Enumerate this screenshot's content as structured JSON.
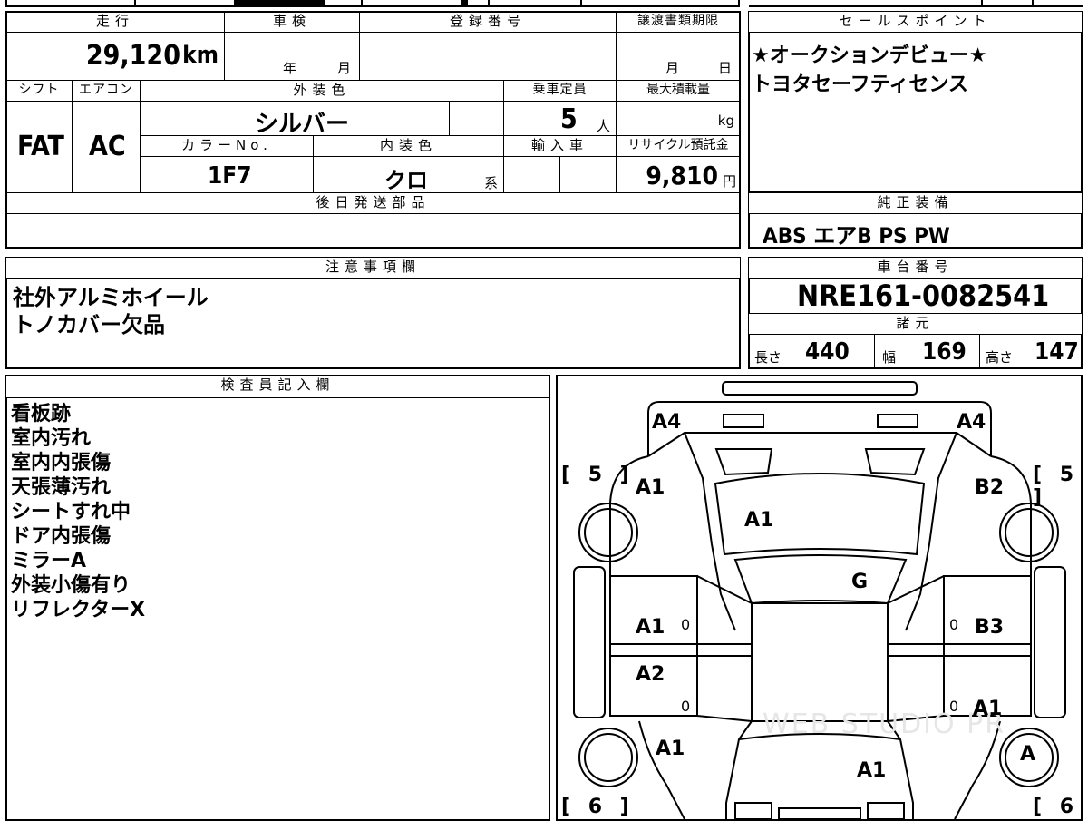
{
  "vehicle": {
    "mileage": {
      "header": "走行",
      "value": "29,120",
      "unit": "km"
    },
    "shaken": {
      "header": "車検",
      "year_unit": "年",
      "month_unit": "月"
    },
    "registration_no": {
      "header": "登録番号"
    },
    "transfer_deadline": {
      "header": "譲渡書類期限",
      "month_unit": "月",
      "day_unit": "日"
    },
    "shift": {
      "header": "シフト",
      "value": "FAT"
    },
    "aircon": {
      "header": "エアコン",
      "value": "AC"
    },
    "exterior_color": {
      "header": "外装色",
      "value": "シルバー"
    },
    "capacity": {
      "header": "乗車定員",
      "value": "5",
      "unit": "人"
    },
    "max_load": {
      "header": "最大積載量",
      "unit": "kg"
    },
    "color_no": {
      "header": "カラーNo.",
      "value": "1F7"
    },
    "interior_color": {
      "header": "内装色",
      "value": "クロ",
      "unit": "系"
    },
    "import": {
      "header": "輸入車"
    },
    "recycle_fee": {
      "header": "リサイクル預託金",
      "value": "9,810",
      "unit": "円"
    },
    "later_parts": {
      "header": "後日発送部品"
    }
  },
  "sales_points": {
    "header": "セールスポイント",
    "lines": [
      "★オークションデビュー★",
      "トヨタセーフティセンス"
    ]
  },
  "equipment": {
    "header": "純正装備",
    "value": "ABS エアB PS PW"
  },
  "notes": {
    "header": "注意事項欄",
    "lines": [
      "社外アルミホイール",
      "トノカバー欠品"
    ]
  },
  "chassis": {
    "header": "車台番号",
    "value": "NRE161-0082541"
  },
  "specs": {
    "header": "諸元",
    "length_label": "長さ",
    "length": "440",
    "width_label": "幅",
    "width": "169",
    "height_label": "高さ",
    "height": "147"
  },
  "inspector": {
    "header": "検査員記入欄",
    "lines": [
      "看板跡",
      "室内汚れ",
      "室内内張傷",
      "天張薄汚れ",
      "シートすれ中",
      "ドア内張傷",
      "ミラーA",
      "外装小傷有り",
      "リフレクターX"
    ]
  },
  "diagram": {
    "grades": {
      "rear_left": "A4",
      "rear_right": "A4",
      "rear_quarter_left": "A1",
      "rear_quarter_right": "B2",
      "rear_glass": "A1",
      "roof": "G",
      "rear_door_left": "A1",
      "rear_door_right": "B3",
      "front_door_left": "A2",
      "front_door_right": "A1",
      "fender_left": "A1",
      "hood": "A1",
      "wheel_front_right": "A"
    },
    "tire_upper_left": "[ 5 ]",
    "tire_upper_right": "[ 5 ]",
    "tire_lower_left": "[ 6 ]",
    "tire_lower_right": "[ 6 ]",
    "zero_mark": "0",
    "watermark": "WEB STUDIO PR"
  }
}
